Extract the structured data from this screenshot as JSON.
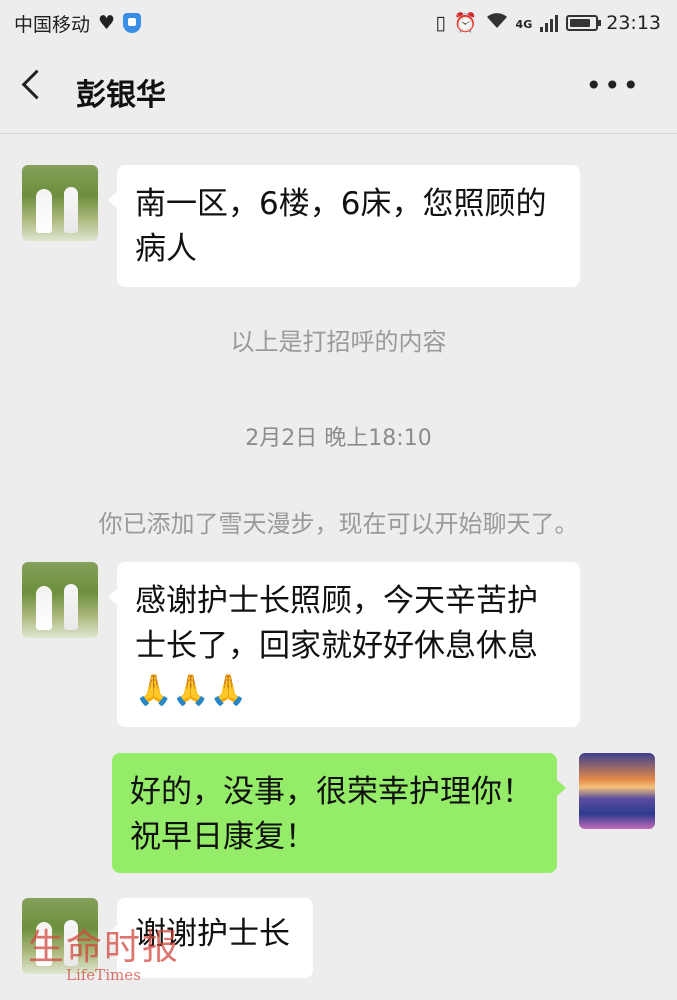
{
  "status_bar": {
    "carrier": "中国移动",
    "network": "4G",
    "time": "23:13"
  },
  "header": {
    "title": "彭银华",
    "more_glyph": "•••"
  },
  "messages": [
    {
      "side": "left",
      "avatar": "couple-photo",
      "text": "南一区，6楼，6床，您照顾的病人"
    },
    {
      "type": "system",
      "text": "以上是打招呼的内容"
    },
    {
      "type": "timestamp",
      "text": "2月2日 晚上18:10"
    },
    {
      "type": "system",
      "text": "你已添加了雪天漫步，现在可以开始聊天了。"
    },
    {
      "side": "left",
      "avatar": "couple-photo",
      "text": "感谢护士长照顾，今天辛苦护士长了，回家就好好休息休息",
      "emoji": "🙏🙏🙏"
    },
    {
      "side": "right",
      "avatar": "sunset-photo",
      "text": "好的，没事，很荣幸护理你！祝早日康复！"
    },
    {
      "side": "left",
      "avatar": "couple-photo",
      "text": "谢谢护士长"
    }
  ],
  "watermark": {
    "text": "生命时报",
    "subtext": "LifeTimes"
  },
  "colors": {
    "background": "#ededed",
    "incoming_bubble": "#ffffff",
    "outgoing_bubble": "#95ec69",
    "system_text": "#9a9a9a"
  }
}
